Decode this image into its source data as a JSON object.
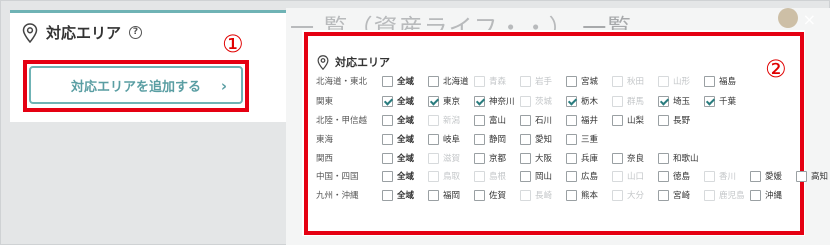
{
  "left": {
    "title": "対応エリア",
    "help_glyph": "?",
    "add_button": "対応エリアを追加する",
    "chevron": "›",
    "badge": "①"
  },
  "background": {
    "title": "一覧",
    "close": "×"
  },
  "modal": {
    "title": "対応エリア",
    "badge": "②",
    "rows": [
      {
        "region": "北海道・東北",
        "items": [
          {
            "label": "全域",
            "all": true,
            "checked": false,
            "disabled": false
          },
          {
            "label": "北海道",
            "checked": false,
            "disabled": false
          },
          {
            "label": "青森",
            "checked": false,
            "disabled": true
          },
          {
            "label": "岩手",
            "checked": false,
            "disabled": true
          },
          {
            "label": "宮城",
            "checked": false,
            "disabled": false
          },
          {
            "label": "秋田",
            "checked": false,
            "disabled": true
          },
          {
            "label": "山形",
            "checked": false,
            "disabled": true
          },
          {
            "label": "福島",
            "checked": false,
            "disabled": false
          }
        ]
      },
      {
        "region": "関東",
        "items": [
          {
            "label": "全域",
            "all": true,
            "checked": true,
            "disabled": false
          },
          {
            "label": "東京",
            "checked": true,
            "disabled": false
          },
          {
            "label": "神奈川",
            "checked": true,
            "disabled": false
          },
          {
            "label": "茨城",
            "checked": false,
            "disabled": true
          },
          {
            "label": "栃木",
            "checked": true,
            "disabled": false
          },
          {
            "label": "群馬",
            "checked": false,
            "disabled": true
          },
          {
            "label": "埼玉",
            "checked": true,
            "disabled": false
          },
          {
            "label": "千葉",
            "checked": true,
            "disabled": false
          }
        ]
      },
      {
        "region": "北陸・甲信越",
        "items": [
          {
            "label": "全域",
            "all": true,
            "checked": false,
            "disabled": false
          },
          {
            "label": "新潟",
            "checked": false,
            "disabled": true
          },
          {
            "label": "富山",
            "checked": false,
            "disabled": false
          },
          {
            "label": "石川",
            "checked": false,
            "disabled": false
          },
          {
            "label": "福井",
            "checked": false,
            "disabled": false
          },
          {
            "label": "山梨",
            "checked": false,
            "disabled": false
          },
          {
            "label": "長野",
            "checked": false,
            "disabled": false
          }
        ]
      },
      {
        "region": "東海",
        "items": [
          {
            "label": "全域",
            "all": true,
            "checked": false,
            "disabled": false
          },
          {
            "label": "岐阜",
            "checked": false,
            "disabled": false
          },
          {
            "label": "静岡",
            "checked": false,
            "disabled": false
          },
          {
            "label": "愛知",
            "checked": false,
            "disabled": false
          },
          {
            "label": "三重",
            "checked": false,
            "disabled": false
          }
        ]
      },
      {
        "region": "関西",
        "items": [
          {
            "label": "全域",
            "all": true,
            "checked": false,
            "disabled": false
          },
          {
            "label": "滋賀",
            "checked": false,
            "disabled": true
          },
          {
            "label": "京都",
            "checked": false,
            "disabled": false
          },
          {
            "label": "大阪",
            "checked": false,
            "disabled": false
          },
          {
            "label": "兵庫",
            "checked": false,
            "disabled": false
          },
          {
            "label": "奈良",
            "checked": false,
            "disabled": false
          },
          {
            "label": "和歌山",
            "checked": false,
            "disabled": false
          }
        ]
      },
      {
        "region": "中国・四国",
        "items": [
          {
            "label": "全域",
            "all": true,
            "checked": false,
            "disabled": false
          },
          {
            "label": "鳥取",
            "checked": false,
            "disabled": true
          },
          {
            "label": "島根",
            "checked": false,
            "disabled": true
          },
          {
            "label": "岡山",
            "checked": false,
            "disabled": false
          },
          {
            "label": "広島",
            "checked": false,
            "disabled": false
          },
          {
            "label": "山口",
            "checked": false,
            "disabled": true
          },
          {
            "label": "徳島",
            "checked": false,
            "disabled": false
          },
          {
            "label": "香川",
            "checked": false,
            "disabled": true
          },
          {
            "label": "愛媛",
            "checked": false,
            "disabled": false
          },
          {
            "label": "高知",
            "checked": false,
            "disabled": false
          }
        ]
      },
      {
        "region": "九州・沖縄",
        "items": [
          {
            "label": "全域",
            "all": true,
            "checked": false,
            "disabled": false
          },
          {
            "label": "福岡",
            "checked": false,
            "disabled": false
          },
          {
            "label": "佐賀",
            "checked": false,
            "disabled": false
          },
          {
            "label": "長崎",
            "checked": false,
            "disabled": true
          },
          {
            "label": "熊本",
            "checked": false,
            "disabled": false
          },
          {
            "label": "大分",
            "checked": false,
            "disabled": true
          },
          {
            "label": "宮崎",
            "checked": false,
            "disabled": false
          },
          {
            "label": "鹿児島",
            "checked": false,
            "disabled": true
          },
          {
            "label": "沖縄",
            "checked": false,
            "disabled": false
          }
        ]
      }
    ]
  },
  "colors": {
    "accent": "#6fb3b5",
    "highlight": "#e50012",
    "check": "#2a7d7f"
  }
}
